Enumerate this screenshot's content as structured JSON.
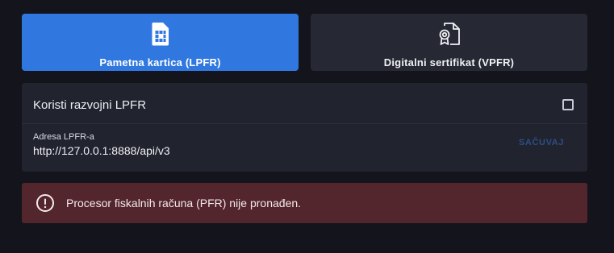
{
  "mode_tiles": [
    {
      "label": "Pametna kartica (LPFR)",
      "icon": "sim-card-icon",
      "selected": true
    },
    {
      "label": "Digitalni sertifikat (VPFR)",
      "icon": "certificate-icon",
      "selected": false
    }
  ],
  "settings": {
    "use_dev_label": "Koristi razvojni LPFR",
    "use_dev_checked": false,
    "address_label": "Adresa LPFR-a",
    "address_value": "http://127.0.0.1:8888/api/v3",
    "save_label": "SAČUVAJ"
  },
  "alert": {
    "icon": "error-circle-icon",
    "message": "Procesor fiskalnih računa (PFR) nije pronađen."
  },
  "colors": {
    "background": "#13141c",
    "accent": "#3078e0",
    "panel": "#21232e",
    "error_background": "#53252c"
  }
}
